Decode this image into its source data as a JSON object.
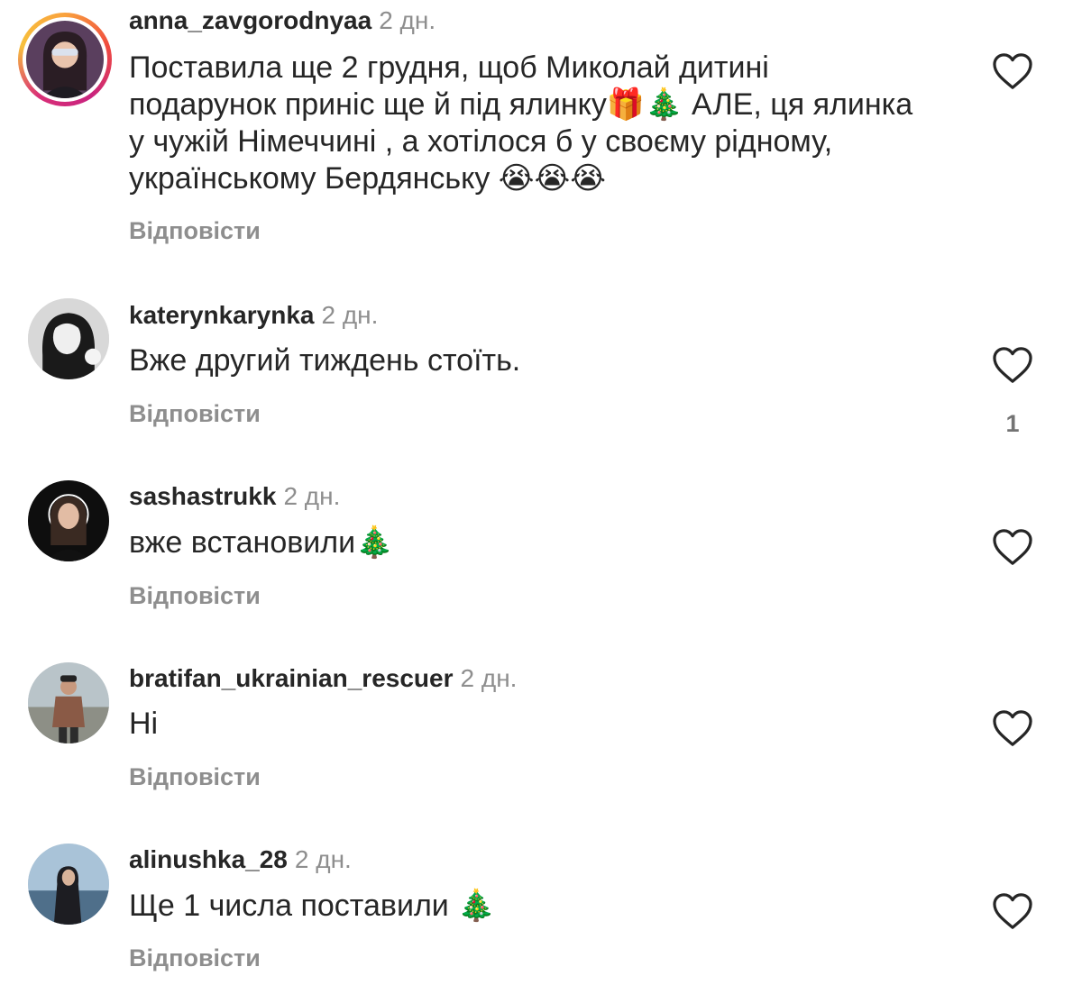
{
  "comments": [
    {
      "username": "anna_zavgorodnyaa",
      "time": "2 дн.",
      "text": "Поставила ще 2 грудня, щоб Миколай дитині подарунок приніс ще й під ялинку🎁🎄 АЛЕ, ця ялинка у чужій Німеччині , а хотілося б у своєму рідному, українському Бердянську 😭😭😭",
      "reply_label": "Відповісти",
      "avatar_ring": true
    },
    {
      "username": "katerynkarynka",
      "time": "2 дн.",
      "text": "Вже другий тиждень стоїть.",
      "reply_label": "Відповісти",
      "like_count": "1"
    },
    {
      "username": "sashastrukk",
      "time": "2 дн.",
      "text": "вже встановили🎄",
      "reply_label": "Відповісти"
    },
    {
      "username": "bratifan_ukrainian_rescuer",
      "time": "2 дн.",
      "text": "Ні",
      "reply_label": "Відповісти"
    },
    {
      "username": "alinushka_28",
      "time": "2 дн.",
      "text": "Ще 1 числа поставили 🎄",
      "reply_label": "Відповісти"
    }
  ],
  "icons": {
    "like": "heart-outline-icon"
  },
  "colors": {
    "text": "#262626",
    "muted": "#8e8e8e",
    "story_ring": "#d92f77"
  }
}
